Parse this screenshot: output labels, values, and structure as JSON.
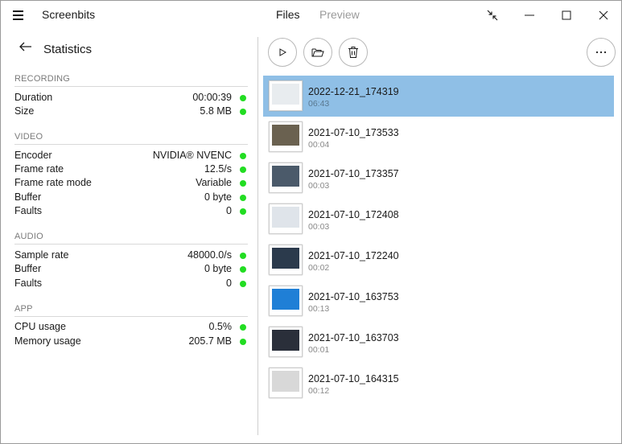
{
  "app": {
    "title": "Screenbits"
  },
  "tabs": [
    {
      "label": "Files",
      "active": true
    },
    {
      "label": "Preview",
      "active": false
    }
  ],
  "stats": {
    "title": "Statistics",
    "sections": [
      {
        "label": "RECORDING",
        "rows": [
          {
            "key": "Duration",
            "value": "00:00:39"
          },
          {
            "key": "Size",
            "value": "5.8 MB"
          }
        ]
      },
      {
        "label": "VIDEO",
        "rows": [
          {
            "key": "Encoder",
            "value": "NVIDIA® NVENC"
          },
          {
            "key": "Frame rate",
            "value": "12.5/s"
          },
          {
            "key": "Frame rate mode",
            "value": "Variable"
          },
          {
            "key": "Buffer",
            "value": "0 byte"
          },
          {
            "key": "Faults",
            "value": "0"
          }
        ]
      },
      {
        "label": "AUDIO",
        "rows": [
          {
            "key": "Sample rate",
            "value": "48000.0/s"
          },
          {
            "key": "Buffer",
            "value": "0 byte"
          },
          {
            "key": "Faults",
            "value": "0"
          }
        ]
      },
      {
        "label": "APP",
        "rows": [
          {
            "key": "CPU usage",
            "value": "0.5%"
          },
          {
            "key": "Memory usage",
            "value": "205.7 MB"
          }
        ]
      }
    ]
  },
  "status_color": "#22dd22",
  "selection_color": "#8fbfe6",
  "toolbar": {
    "play_icon": "play-icon",
    "folder_icon": "folder-open-icon",
    "delete_icon": "trash-icon",
    "more_icon": "more-icon"
  },
  "files": [
    {
      "name": "2022-12-21_174319",
      "duration": "06:43",
      "selected": true,
      "thumb_color": "#e8ecef"
    },
    {
      "name": "2021-07-10_173533",
      "duration": "00:04",
      "selected": false,
      "thumb_color": "#6a6150"
    },
    {
      "name": "2021-07-10_173357",
      "duration": "00:03",
      "selected": false,
      "thumb_color": "#4b5a6a"
    },
    {
      "name": "2021-07-10_172408",
      "duration": "00:03",
      "selected": false,
      "thumb_color": "#dfe4ea"
    },
    {
      "name": "2021-07-10_172240",
      "duration": "00:02",
      "selected": false,
      "thumb_color": "#2b3a4c"
    },
    {
      "name": "2021-07-10_163753",
      "duration": "00:13",
      "selected": false,
      "thumb_color": "#1f7fd6"
    },
    {
      "name": "2021-07-10_163703",
      "duration": "00:01",
      "selected": false,
      "thumb_color": "#2a2f3a"
    },
    {
      "name": "2021-07-10_164315",
      "duration": "00:12",
      "selected": false,
      "thumb_color": "#d8d8d8"
    }
  ]
}
